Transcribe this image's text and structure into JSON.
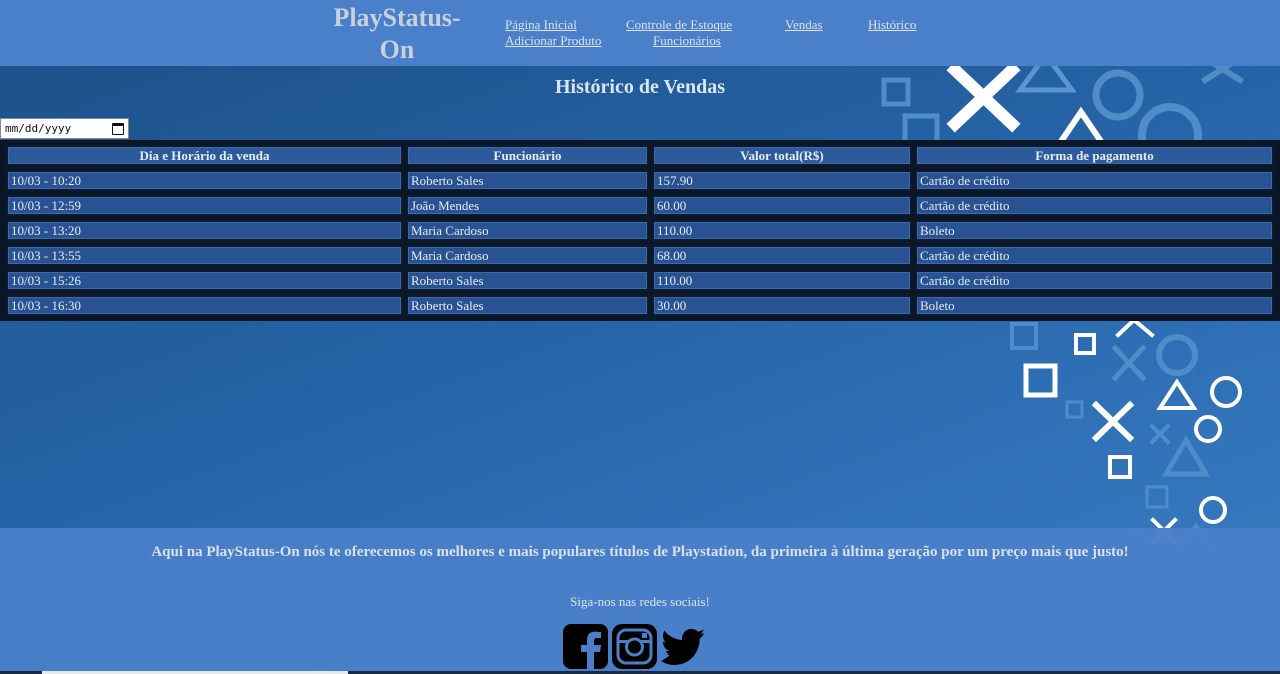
{
  "header": {
    "brand": "PlayStatus-On",
    "nav": [
      {
        "label": "Página Inicial"
      },
      {
        "label": "Controle de Estoque"
      },
      {
        "label": "Vendas"
      },
      {
        "label": "Histórico"
      },
      {
        "label": "Adicionar Produto"
      },
      {
        "label": "Funcionários"
      }
    ]
  },
  "main": {
    "title": "Histórico de Vendas",
    "date_filter": {
      "placeholder": "mm/dd/yyyy",
      "value": ""
    },
    "table": {
      "columns": [
        "Dia e Horário da venda",
        "Funcionário",
        "Valor total(R$)",
        "Forma de pagamento"
      ],
      "rows": [
        [
          "10/03 - 10:20",
          "Roberto Sales",
          "157.90",
          "Cartão de crédito"
        ],
        [
          "10/03 - 12:59",
          "João Mendes",
          "60.00",
          "Cartão de crédito"
        ],
        [
          "10/03 - 13:20",
          "Maria Cardoso",
          "110.00",
          "Boleto"
        ],
        [
          "10/03 - 13:55",
          "Maria Cardoso",
          "68.00",
          "Cartão de crédito"
        ],
        [
          "10/03 - 15:26",
          "Roberto Sales",
          "110.00",
          "Cartão de crédito"
        ],
        [
          "10/03 - 16:30",
          "Roberto Sales",
          "30.00",
          "Boleto"
        ]
      ]
    }
  },
  "footer": {
    "tagline": "Aqui na PlayStatus-On nós te oferecemos os melhores e mais populares títulos de Playstation, da primeira à última geração por um preço mais que justo!",
    "follow_text": "Siga-nos nas redes sociais!",
    "social_icons": [
      "facebook-icon",
      "instagram-icon",
      "twitter-icon"
    ]
  },
  "colors": {
    "header_bg": "#4a7fc9",
    "page_bg": "#2563a6",
    "table_bg": "#0b1626",
    "cell_bg": "#285291"
  }
}
